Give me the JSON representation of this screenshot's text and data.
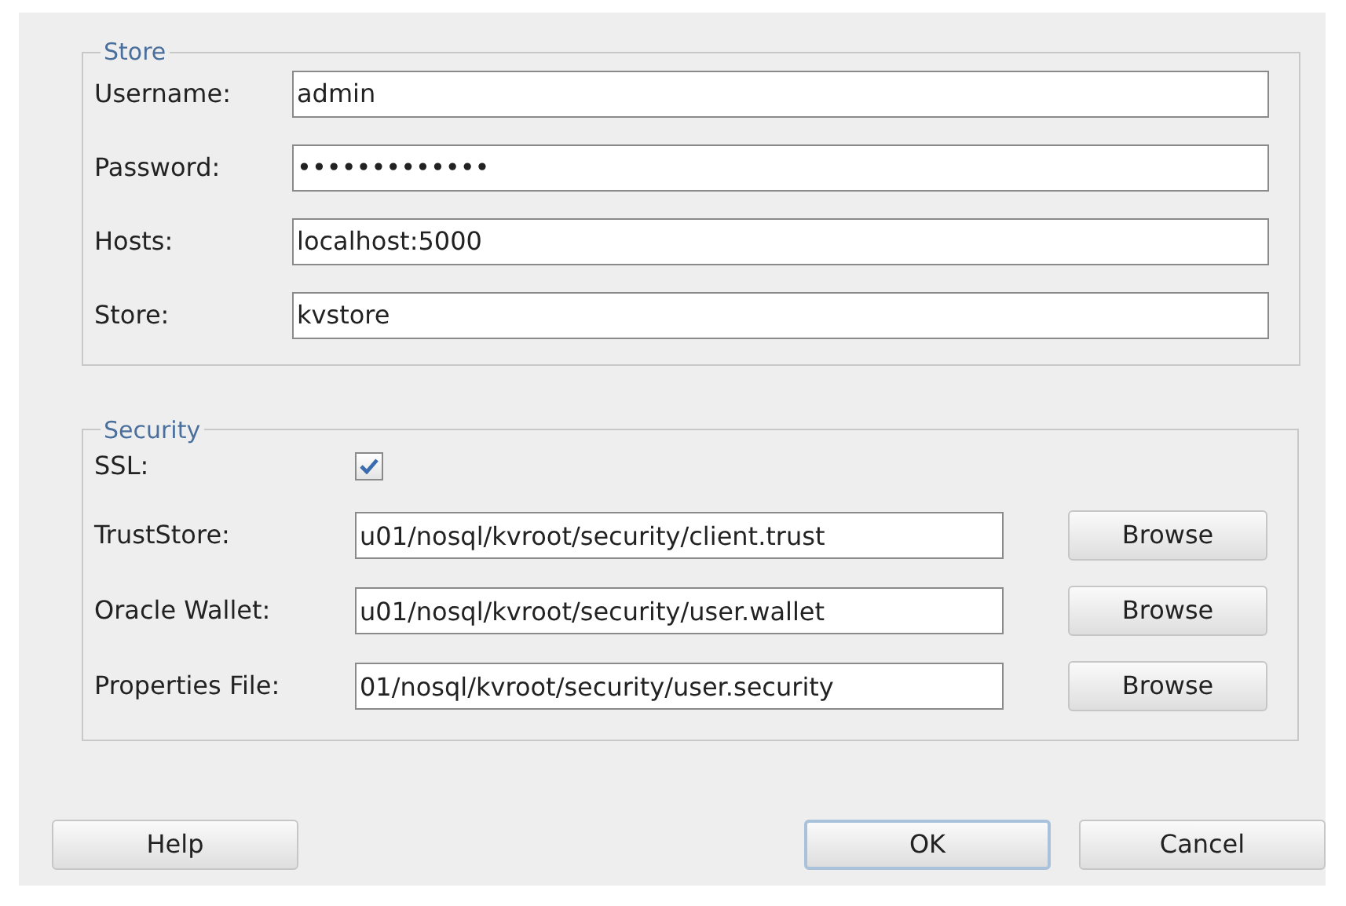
{
  "store_group": {
    "title": "Store",
    "fields": [
      {
        "label": "Username:",
        "value": "admin"
      },
      {
        "label": "Password:",
        "value": "•••••••••••••"
      },
      {
        "label": "Hosts:",
        "value": "localhost:5000"
      },
      {
        "label": "Store:",
        "value": "kvstore"
      }
    ]
  },
  "security_group": {
    "title": "Security",
    "rows": [
      {
        "kind": "checkbox",
        "label": "SSL:",
        "checked": true
      },
      {
        "kind": "file",
        "label": "TrustStore:",
        "value": "u01/nosql/kvroot/security/client.trust",
        "button": "Browse"
      },
      {
        "kind": "file",
        "label": "Oracle Wallet:",
        "value": "u01/nosql/kvroot/security/user.wallet",
        "button": "Browse"
      },
      {
        "kind": "file",
        "label": "Properties File:",
        "value": "01/nosql/kvroot/security/user.security",
        "button": "Browse"
      }
    ]
  },
  "buttons": [
    {
      "label": "Help",
      "default": false
    },
    {
      "label": "OK",
      "default": true
    },
    {
      "label": "Cancel",
      "default": false
    }
  ]
}
